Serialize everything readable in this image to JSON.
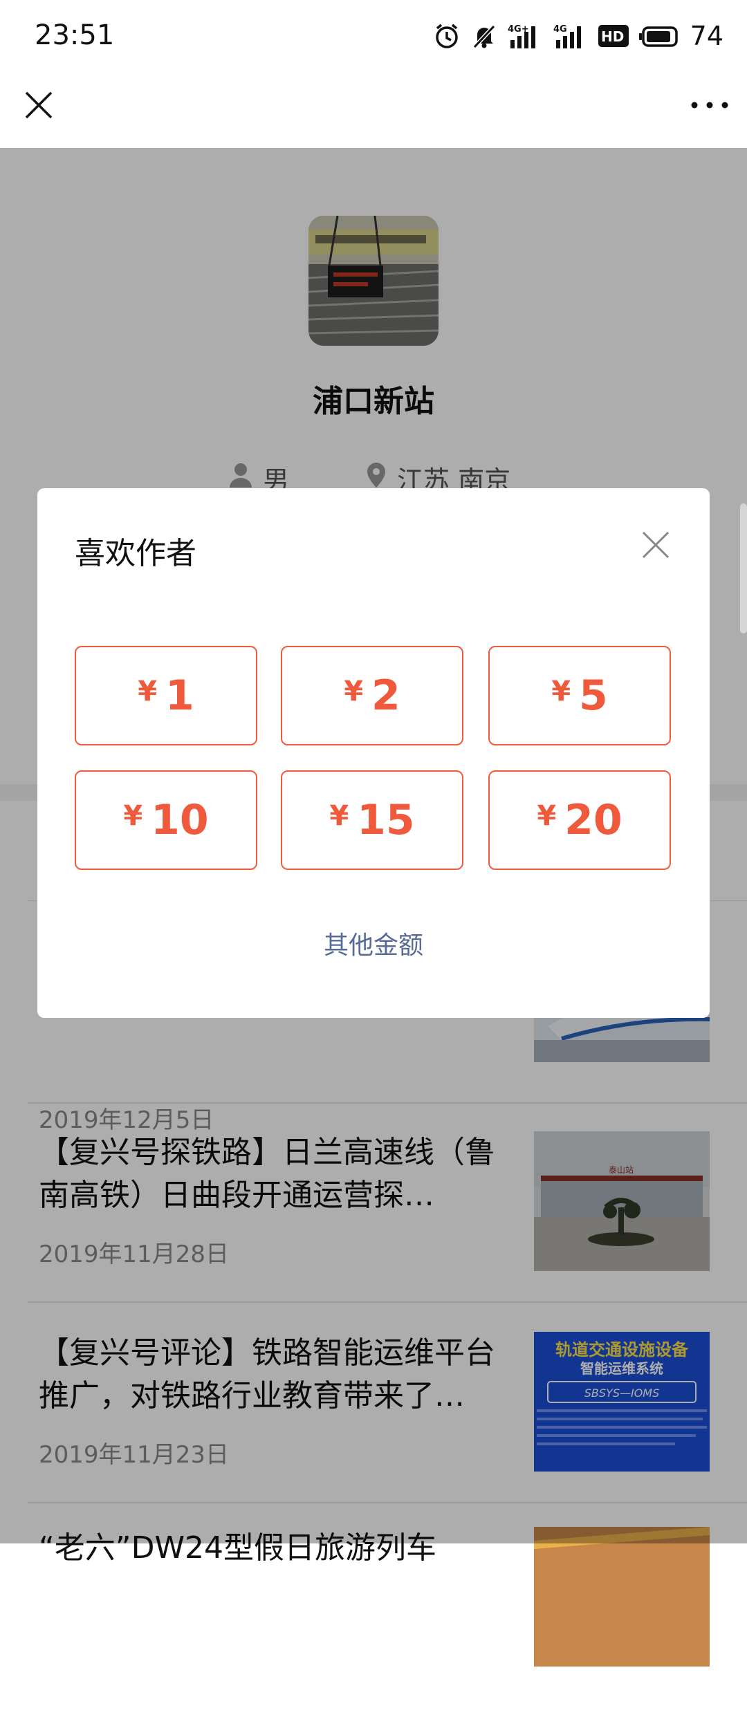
{
  "status_bar": {
    "time": "23:51",
    "battery": "74",
    "icons": [
      "alarm-icon",
      "mute-icon",
      "signal-4g-plus-icon",
      "signal-4g-icon",
      "hd-icon",
      "battery-icon"
    ]
  },
  "title_bar": {
    "close_icon": "close-icon",
    "more_icon": "more-icon"
  },
  "profile": {
    "name": "浦口新站",
    "gender": "男",
    "location": "江苏 南京"
  },
  "articles": [
    {
      "title": "",
      "date": "2019年12月5日",
      "thumb": "high-speed-train"
    },
    {
      "title": "【复兴号探铁路】日兰高速线（鲁南高铁）日曲段开通运营探…",
      "date": "2019年11月28日",
      "thumb": "station-building"
    },
    {
      "title": "【复兴号评论】铁路智能运维平台推广，对铁路行业教育带来了…",
      "date": "2019年11月23日",
      "thumb": "blue-banner"
    },
    {
      "title": "“老六”DW24型假日旅游列车",
      "date": "",
      "thumb": "train-orange"
    }
  ],
  "thumb_texts": {
    "station_sign": "泰山站",
    "banner_line1": "轨道交通设施设备",
    "banner_line2": "智能运维系统",
    "banner_logo": "SBSYS—IOMS"
  },
  "dialog": {
    "title": "喜欢作者",
    "currency": "¥",
    "amounts": [
      "1",
      "2",
      "5",
      "10",
      "15",
      "20"
    ],
    "other_label": "其他金额"
  },
  "colors": {
    "accent": "#f05a3c",
    "link": "#576b95",
    "overlay": "rgba(0,0,0,0.32)"
  }
}
